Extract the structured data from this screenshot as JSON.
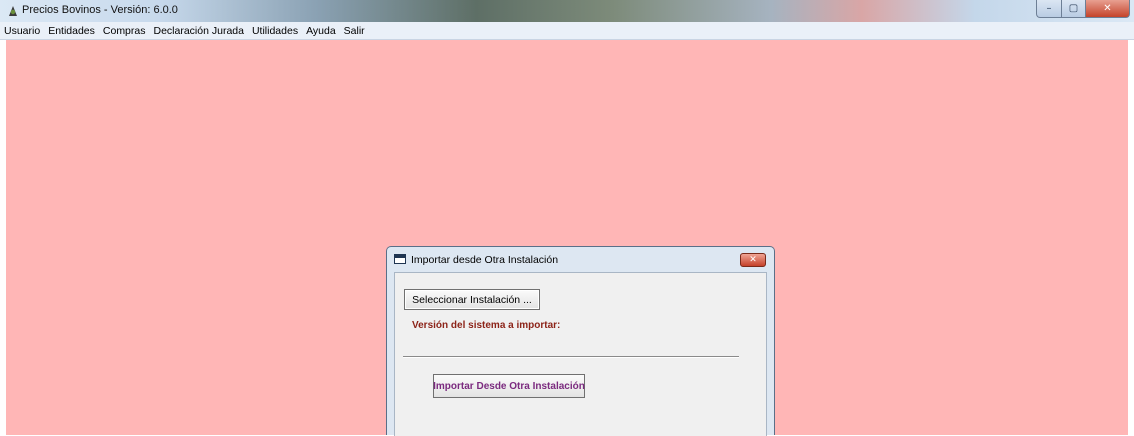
{
  "window": {
    "title": "Precios Bovinos - Versión: 6.0.0",
    "controls": {
      "minimize": "–",
      "maximize": "▢",
      "close": "✕"
    }
  },
  "menu": {
    "items": [
      "Usuario",
      "Entidades",
      "Compras",
      "Declaración Jurada",
      "Utilidades",
      "Ayuda",
      "Salir"
    ]
  },
  "desktop": {
    "background_color": "#ffb6b6"
  },
  "dialog": {
    "title": "Importar desde Otra Instalación",
    "close_label": "✕",
    "select_button": "Seleccionar Instalación ...",
    "version_label": "Versión del sistema a  importar:",
    "import_button": "Importar Desde Otra Instalación"
  },
  "colors": {
    "version_label": "#8c2318",
    "import_button_text": "#7b2a7f",
    "close_button": "#c5412a"
  }
}
